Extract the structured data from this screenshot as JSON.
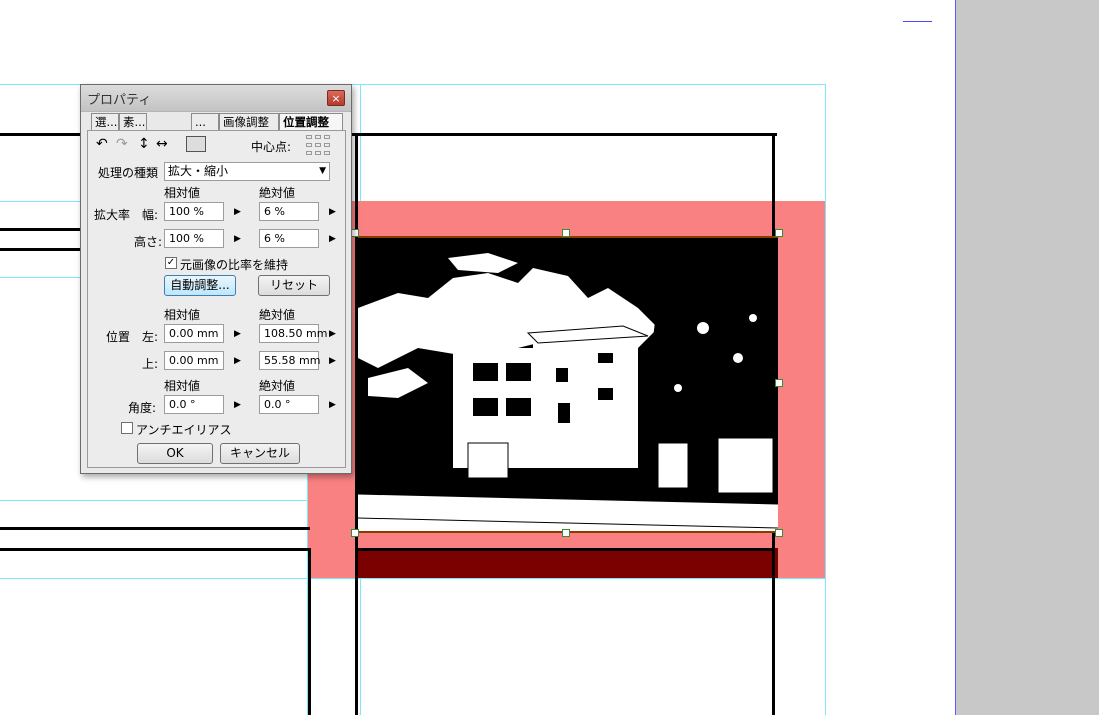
{
  "dialog": {
    "title": "プロパティ",
    "close_label": "×",
    "tabs": [
      "選...",
      "素...",
      "...",
      "画像調整",
      "位置調整"
    ],
    "center_point_label": "中心点:",
    "process_type_label": "処理の種類",
    "process_type_value": "拡大・縮小",
    "relative_header": "相対値",
    "absolute_header": "絶対値",
    "scale_label": "拡大率",
    "width_label": "幅:",
    "height_label": "高さ:",
    "scale_width_rel": "100 %",
    "scale_width_abs": "6 %",
    "scale_height_rel": "100 %",
    "scale_height_abs": "6 %",
    "keep_ratio_label": "元画像の比率を維持",
    "keep_ratio_checked": true,
    "auto_adjust_label": "自動調整...",
    "reset_label": "リセット",
    "position_label": "位置",
    "left_label": "左:",
    "top_label": "上:",
    "pos_left_rel": "0.00 mm",
    "pos_left_abs": "108.50 mm",
    "pos_top_rel": "0.00 mm",
    "pos_top_abs": "55.58 mm",
    "angle_label": "角度:",
    "angle_rel": "0.0 °",
    "angle_abs": "0.0 °",
    "antialias_label": "アンチエイリアス",
    "antialias_checked": false,
    "ok_label": "OK",
    "cancel_label": "キャンセル"
  },
  "colors": {
    "bleed": "#f98181",
    "guide": "#7fe6ff",
    "panel_gray": "#c8c8c8"
  }
}
